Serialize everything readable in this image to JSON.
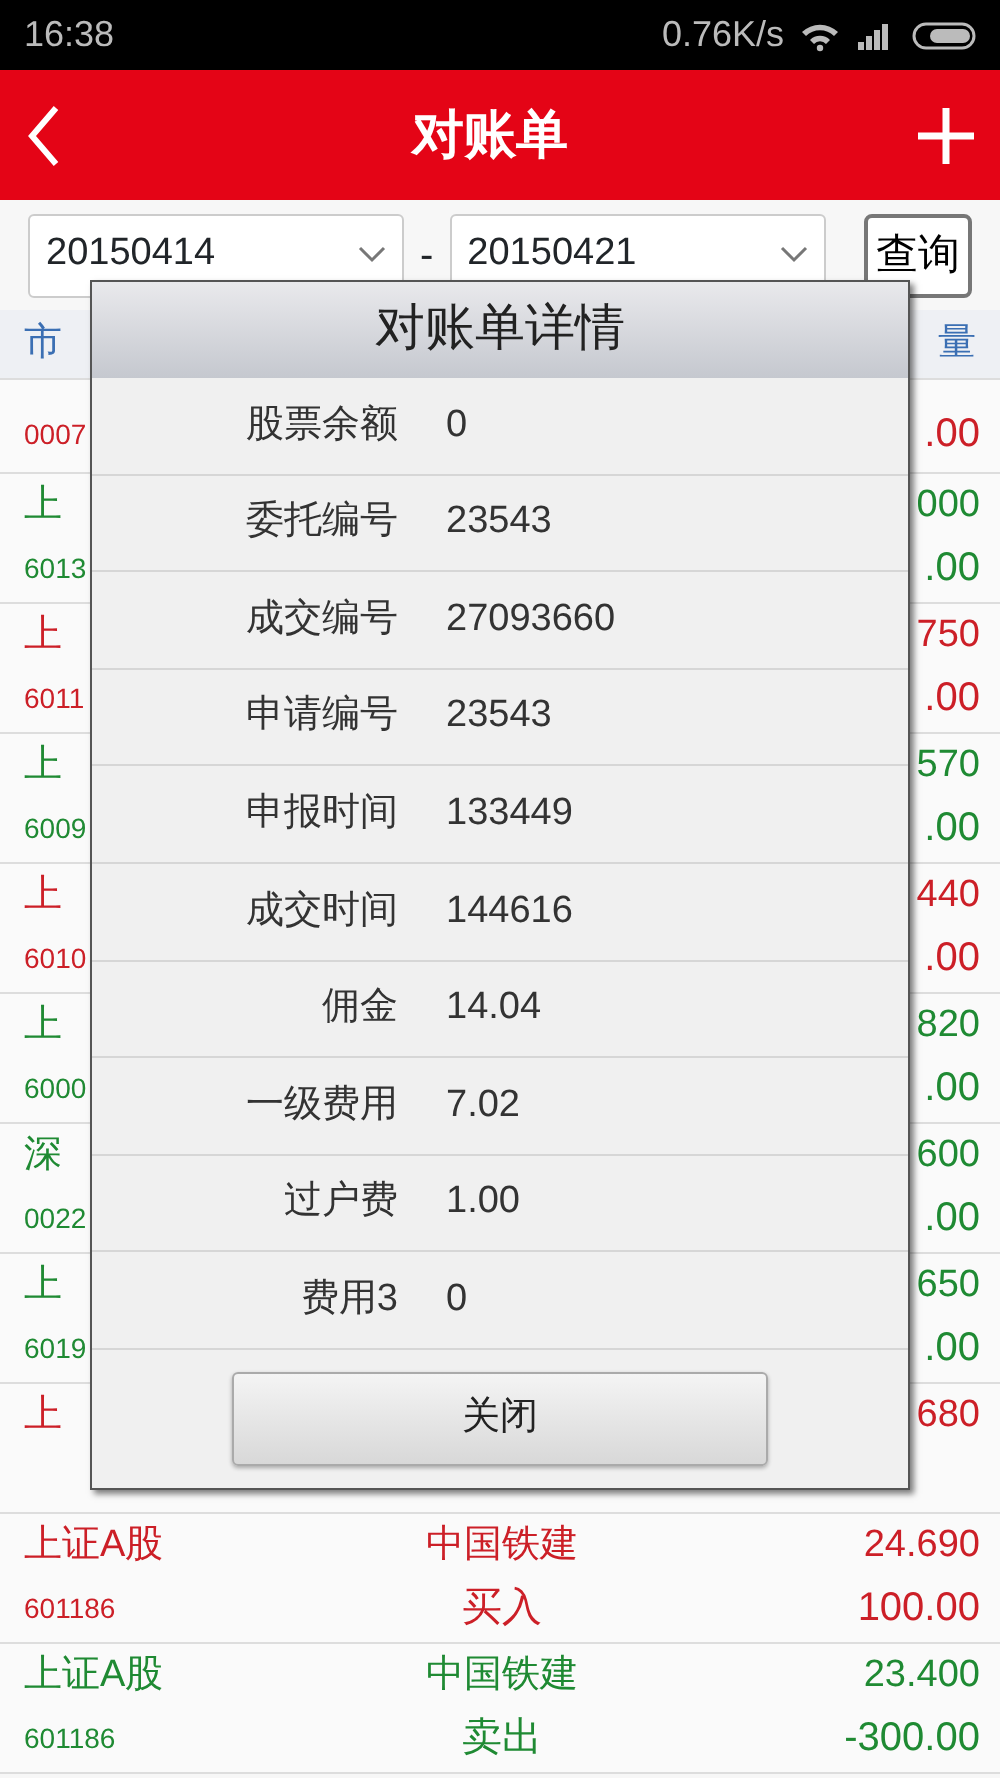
{
  "status_bar": {
    "time": "16:38",
    "speed": "0.76K/s"
  },
  "app_bar": {
    "title": "对账单"
  },
  "filter": {
    "start_date": "20150414",
    "separator": "-",
    "end_date": "20150421",
    "query_button": "查询"
  },
  "table": {
    "header_left": "市",
    "header_right": "量",
    "rows": [
      {
        "code": "0007",
        "amount": ".00",
        "color": "#cc1f27"
      },
      {
        "market": "上",
        "code": "6013",
        "price": "000",
        "amount": ".00",
        "color": "#1f8a33"
      },
      {
        "market": "上",
        "code": "6011",
        "price": "750",
        "amount": ".00",
        "color": "#cc1f27"
      },
      {
        "market": "上",
        "code": "6009",
        "price": "570",
        "amount": ".00",
        "color": "#1f8a33"
      },
      {
        "market": "上",
        "code": "6010",
        "price": "440",
        "amount": ".00",
        "color": "#cc1f27"
      },
      {
        "market": "上",
        "code": "6000",
        "price": "820",
        "amount": ".00",
        "color": "#1f8a33"
      },
      {
        "market": "深",
        "code": "0022",
        "price": "600",
        "amount": ".00",
        "color": "#1f8a33"
      },
      {
        "market": "上",
        "code": "6019",
        "price": "650",
        "amount": ".00",
        "color": "#1f8a33"
      },
      {
        "market": "上",
        "price": "680",
        "color": "#cc1f27"
      },
      {
        "market": "上证A股",
        "name": "中国铁建",
        "price": "24.690",
        "code": "601186",
        "side": "买入",
        "amount": "100.00",
        "color": "#cc1f27"
      },
      {
        "market": "上证A股",
        "name": "中国铁建",
        "price": "23.400",
        "code": "601186",
        "side": "卖出",
        "amount": "-300.00",
        "color": "#1f8a33"
      }
    ]
  },
  "dialog": {
    "title": "对账单详情",
    "fields": [
      {
        "label": "股票余额",
        "value": "0"
      },
      {
        "label": "委托编号",
        "value": "23543"
      },
      {
        "label": "成交编号",
        "value": "27093660"
      },
      {
        "label": "申请编号",
        "value": "23543"
      },
      {
        "label": "申报时间",
        "value": "133449"
      },
      {
        "label": "成交时间",
        "value": "144616"
      },
      {
        "label": "佣金",
        "value": "14.04"
      },
      {
        "label": "一级费用",
        "value": "7.02"
      },
      {
        "label": "过户费",
        "value": "1.00"
      },
      {
        "label": "费用3",
        "value": "0"
      }
    ],
    "close_button": "关闭"
  }
}
